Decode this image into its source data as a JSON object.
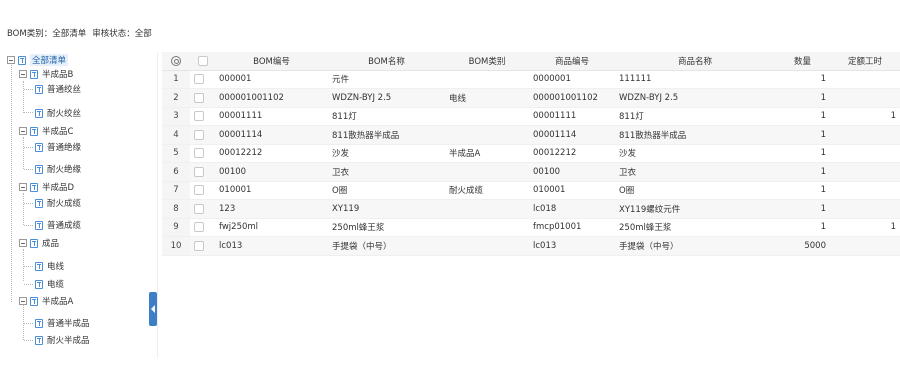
{
  "filter": {
    "category_label": "BOM类别：",
    "category_value": "全部清单",
    "status_label": "审核状态：",
    "status_value": "全部"
  },
  "tree": {
    "root": "全部清单",
    "groups": [
      {
        "label": "半成品B",
        "children": [
          "普通绞丝",
          "耐火绞丝"
        ]
      },
      {
        "label": "半成品C",
        "children": [
          "普通绝缘",
          "耐火绝缘"
        ]
      },
      {
        "label": "半成品D",
        "children": [
          "耐火成缆",
          "普通成缆"
        ]
      },
      {
        "label": "成品",
        "children": [
          "电线",
          "电缆"
        ]
      },
      {
        "label": "半成品A",
        "children": [
          "普通半成品",
          "耐火半成品"
        ]
      }
    ]
  },
  "table": {
    "columns": [
      "BOM编号",
      "BOM名称",
      "BOM类别",
      "商品编号",
      "商品名称",
      "数量",
      "定额工时"
    ],
    "rows": [
      {
        "n": "1",
        "bom_no": "000001",
        "bom_name": "元件",
        "bom_type": "",
        "item_no": "0000001",
        "item_name": "111111",
        "qty": "1",
        "hours": ""
      },
      {
        "n": "2",
        "bom_no": "000001001102",
        "bom_name": "WDZN-BYJ 2.5",
        "bom_type": "电线",
        "item_no": "000001001102",
        "item_name": "WDZN-BYJ 2.5",
        "qty": "1",
        "hours": ""
      },
      {
        "n": "3",
        "bom_no": "00001111",
        "bom_name": "811灯",
        "bom_type": "",
        "item_no": "00001111",
        "item_name": "811灯",
        "qty": "1",
        "hours": "1"
      },
      {
        "n": "4",
        "bom_no": "00001114",
        "bom_name": "811散热器半成品",
        "bom_type": "",
        "item_no": "00001114",
        "item_name": "811散热器半成品",
        "qty": "1",
        "hours": ""
      },
      {
        "n": "5",
        "bom_no": "00012212",
        "bom_name": "沙发",
        "bom_type": "半成品A",
        "item_no": "00012212",
        "item_name": "沙发",
        "qty": "1",
        "hours": ""
      },
      {
        "n": "6",
        "bom_no": "00100",
        "bom_name": "卫衣",
        "bom_type": "",
        "item_no": "00100",
        "item_name": "卫衣",
        "qty": "1",
        "hours": ""
      },
      {
        "n": "7",
        "bom_no": "010001",
        "bom_name": "O圈",
        "bom_type": "耐火成缆",
        "item_no": "010001",
        "item_name": "O圈",
        "qty": "1",
        "hours": ""
      },
      {
        "n": "8",
        "bom_no": "123",
        "bom_name": "XY119",
        "bom_type": "",
        "item_no": "lc018",
        "item_name": "XY119螺纹元件",
        "qty": "1",
        "hours": ""
      },
      {
        "n": "9",
        "bom_no": "fwj250ml",
        "bom_name": "250ml蜂王浆",
        "bom_type": "",
        "item_no": "fmcp01001",
        "item_name": "250ml蜂王浆",
        "qty": "1",
        "hours": "1"
      },
      {
        "n": "10",
        "bom_no": "lc013",
        "bom_name": "手提袋（中号）",
        "bom_type": "",
        "item_no": "lc013",
        "item_name": "手提袋（中号）",
        "qty": "5000",
        "hours": ""
      }
    ]
  },
  "icons": {
    "settings": "gear-icon",
    "tree_node": "table-node-icon",
    "splitter": "collapse-left-icon"
  },
  "colors": {
    "accent": "#3d7fc7",
    "selected_bg": "#e6f0fb"
  }
}
